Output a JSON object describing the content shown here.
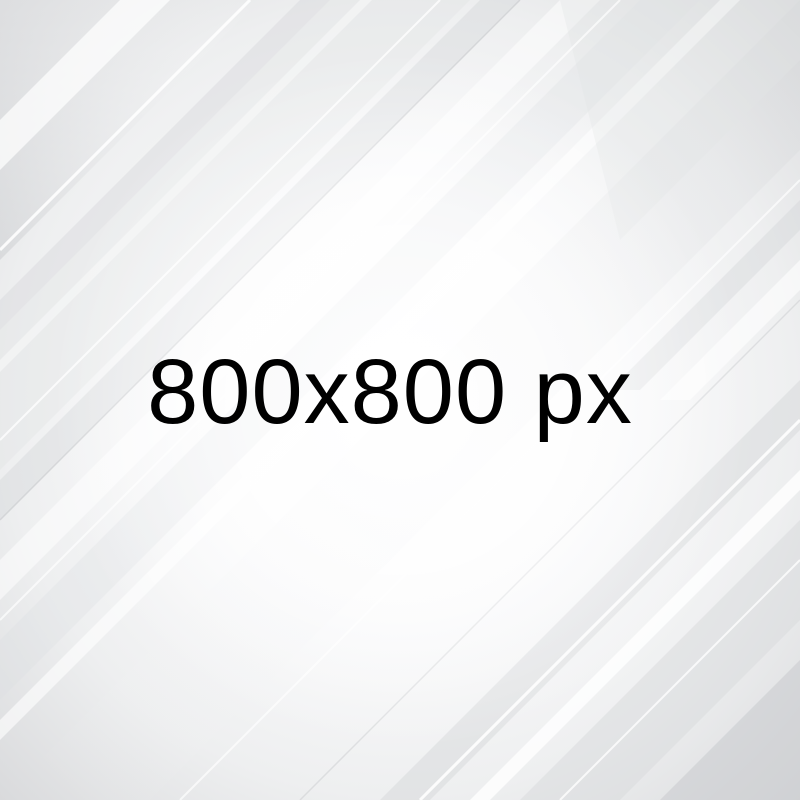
{
  "label": "800x800 px",
  "colors": {
    "text": "#000000",
    "background": "#ffffff",
    "stripe_light": "#f2f3f4",
    "stripe_mid": "#d9dadc",
    "stripe_dark": "#c4c6c9"
  }
}
